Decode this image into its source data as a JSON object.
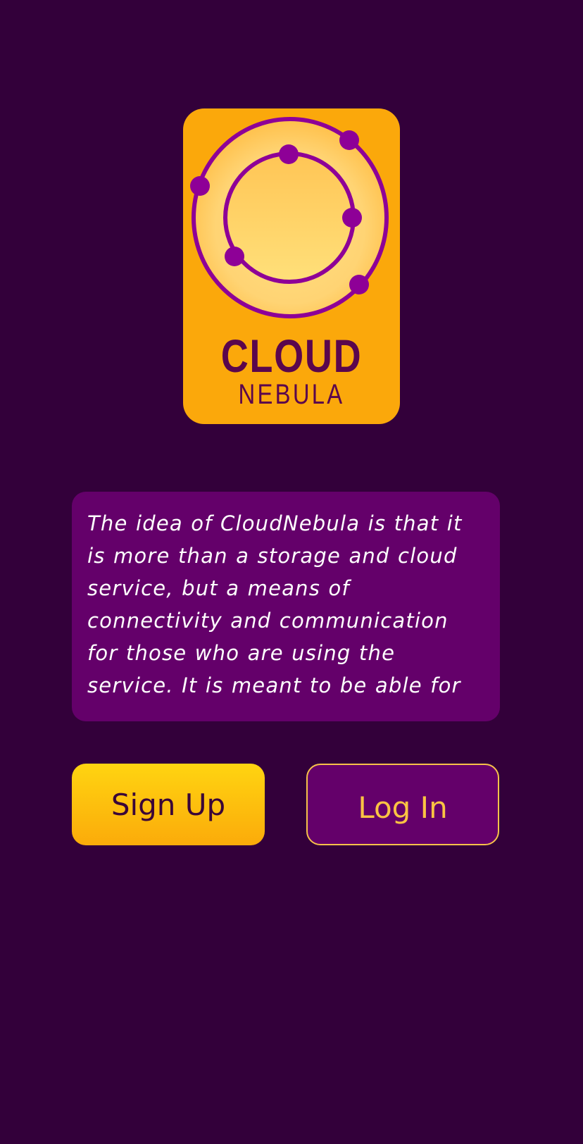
{
  "logo": {
    "title": "CLOUD",
    "subtitle": "NEBULA"
  },
  "description": "The idea of CloudNebula is that it is more than a storage and cloud service, but a means of connectivity and communication for those who are using the service. It is meant to be able for",
  "buttons": {
    "signup_label": "Sign Up",
    "login_label": "Log In"
  },
  "colors": {
    "background": "#33003a",
    "logo_card": "#fba80b",
    "accent_purple": "#64006a",
    "orbit_purple": "#8e0097",
    "signup_yellow": "#ffd411",
    "login_text": "#fbc343"
  }
}
